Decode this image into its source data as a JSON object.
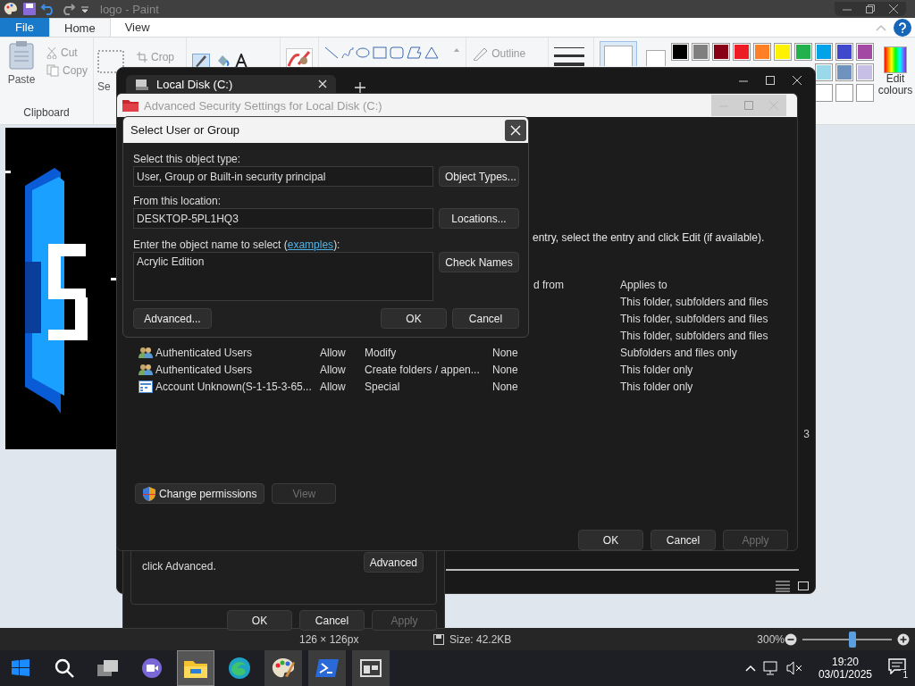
{
  "paint": {
    "title": "logo - Paint",
    "tabs": [
      {
        "label": "File",
        "kind": "file",
        "selected": false
      },
      {
        "label": "Home",
        "kind": "tab",
        "selected": true
      },
      {
        "label": "View",
        "kind": "tab",
        "selected": false
      }
    ],
    "clipboard": {
      "paste": "Paste",
      "cut": "Cut",
      "copy": "Copy",
      "group": "Clipboard"
    },
    "image": {
      "select": "Se",
      "crop": "Crop"
    },
    "outline": "Outline",
    "palette": [
      {
        "color": "#000000"
      },
      {
        "color": "#7f7f7f"
      },
      {
        "color": "#880015"
      },
      {
        "color": "#ed1c24"
      },
      {
        "color": "#ff7f27"
      },
      {
        "color": "#fff200"
      },
      {
        "color": "#22b14c"
      },
      {
        "color": "#00a2e8"
      },
      {
        "color": "#3f48cc"
      },
      {
        "color": "#a349a4"
      }
    ],
    "palette_row2": [
      {
        "color": "#99d9ea"
      },
      {
        "color": "#7092be"
      },
      {
        "color": "#c8bfe7"
      }
    ],
    "palette_row3": [
      {
        "color": "#ffffff"
      },
      {
        "color": "#ffffff"
      },
      {
        "color": "#ffffff"
      }
    ],
    "edit_colours": "Edit colours",
    "status": {
      "dimensions": "126 × 126px",
      "size": "Size: 42.2KB",
      "zoom": "300%",
      "level": 0.56
    }
  },
  "explorer": {
    "tab": "Local Disk (C:)",
    "side_text": "3"
  },
  "properties": {
    "note": "click Advanced.",
    "advanced": "Advanced",
    "buttons": [
      {
        "label": "OK",
        "disabled": false
      },
      {
        "label": "Cancel",
        "disabled": false
      },
      {
        "label": "Apply",
        "disabled": true
      }
    ]
  },
  "advanced_security": {
    "title": "Advanced Security Settings for Local Disk (C:)",
    "instruction": "entry, select the entry and click Edit (if available).",
    "columns": [
      "d from",
      "Applies to"
    ],
    "entries": [
      {
        "applies_to": "This folder, subfolders and files"
      },
      {
        "applies_to": "This folder, subfolders and files"
      },
      {
        "applies_to": "This folder, subfolders and files"
      },
      {
        "kind": "group",
        "principal": "Authenticated Users",
        "type": "Allow",
        "access": "Modify",
        "inherited_from": "None",
        "applies_to": "Subfolders and files only"
      },
      {
        "kind": "group",
        "principal": "Authenticated Users",
        "type": "Allow",
        "access": "Create folders / appen...",
        "inherited_from": "None",
        "applies_to": "This folder only"
      },
      {
        "kind": "account",
        "principal": "Account Unknown(S-1-15-3-65...",
        "type": "Allow",
        "access": "Special",
        "inherited_from": "None",
        "applies_to": "This folder only"
      }
    ],
    "change_permissions": "Change permissions",
    "view": {
      "label": "View",
      "disabled": true
    },
    "buttons": [
      {
        "label": "OK",
        "disabled": false
      },
      {
        "label": "Cancel",
        "disabled": false
      },
      {
        "label": "Apply",
        "disabled": true
      }
    ]
  },
  "select_dialog": {
    "title": "Select User or Group",
    "object_type_label": "Select this object type:",
    "object_type": "User, Group or Built-in security principal",
    "object_types_button": "Object Types...",
    "location_label": "From this location:",
    "location": "DESKTOP-5PL1HQ3",
    "locations_button": "Locations...",
    "name_label_before": "Enter the object name to select (",
    "examples": "examples",
    "name_label_after": "):",
    "name_value": "Acrylic Edition",
    "check_names": "Check Names",
    "advanced": "Advanced...",
    "ok": "OK",
    "cancel": "Cancel"
  },
  "taskbar": {
    "apps": [
      {
        "kind": "start",
        "selected": false
      },
      {
        "kind": "search",
        "selected": false
      },
      {
        "kind": "task-view",
        "selected": false
      },
      {
        "kind": "chat",
        "selected": false
      },
      {
        "kind": "explorer",
        "selected": true
      },
      {
        "kind": "edge",
        "selected": false
      },
      {
        "kind": "paint",
        "selected": false
      },
      {
        "kind": "terminal",
        "selected": false
      },
      {
        "kind": "app",
        "selected": false
      }
    ],
    "time": "19:20",
    "date": "03/01/2025",
    "notifications": "1"
  }
}
